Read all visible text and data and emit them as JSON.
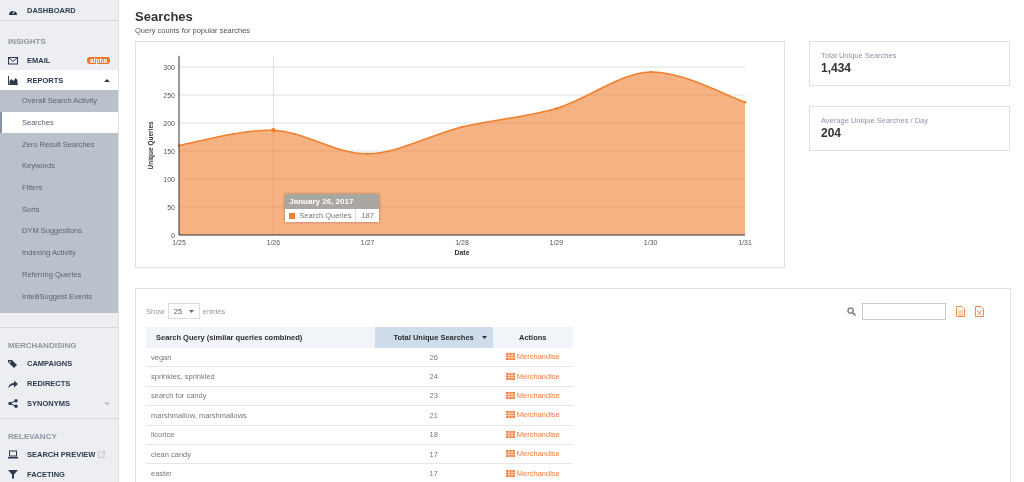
{
  "sidebar": {
    "top_items": [
      {
        "label": "DASHBOARD"
      }
    ],
    "sections": [
      {
        "heading": "INSIGHTS",
        "items": [
          {
            "label": "EMAIL",
            "badge": "alpha"
          },
          {
            "label": "REPORTS",
            "expanded": true,
            "children": [
              {
                "label": "Overall Search Activity",
                "selected": false
              },
              {
                "label": "Searches",
                "selected": true
              },
              {
                "label": "Zero Result Searches",
                "selected": false
              },
              {
                "label": "Keywords",
                "selected": false
              },
              {
                "label": "Filters",
                "selected": false
              },
              {
                "label": "Sorts",
                "selected": false
              },
              {
                "label": "DYM Suggestions",
                "selected": false
              },
              {
                "label": "Indexing Activity",
                "selected": false
              },
              {
                "label": "Referring Queries",
                "selected": false
              },
              {
                "label": "IntelliSuggest Events",
                "selected": false
              }
            ]
          }
        ]
      },
      {
        "heading": "MERCHANDISING",
        "items": [
          {
            "label": "CAMPAIGNS"
          },
          {
            "label": "REDIRECTS"
          },
          {
            "label": "SYNONYMS",
            "expanded": false
          }
        ]
      },
      {
        "heading": "RELEVANCY",
        "items": [
          {
            "label": "SEARCH PREVIEW",
            "external": true
          },
          {
            "label": "FACETING"
          }
        ]
      }
    ]
  },
  "page": {
    "title": "Searches",
    "subtitle": "Query counts for popular searches"
  },
  "chart": {
    "chart_data": {
      "type": "area",
      "xlabel": "Date",
      "ylabel": "Unique Queries",
      "categories": [
        "1/25",
        "1/26",
        "1/27",
        "1/28",
        "1/29",
        "1/30",
        "1/31"
      ],
      "series": [
        {
          "name": "Search Queries",
          "color": "#f07f2e",
          "values": [
            160,
            187,
            145,
            193,
            226,
            291,
            237
          ]
        }
      ],
      "ylim": [
        0,
        320
      ],
      "yticks": [
        0,
        50,
        100,
        150,
        200,
        250,
        300
      ],
      "grid": true
    },
    "tooltip": {
      "title": "January 26, 2017",
      "value": "187"
    }
  },
  "stats": [
    {
      "label": "Total Unique Searches",
      "value": "1,434"
    },
    {
      "label": "Average Unique Searches / Day",
      "value": "204"
    }
  ],
  "table": {
    "show_label": "Show",
    "page_size": "25",
    "entries_label": "entries",
    "columns": [
      {
        "label": "Search Query (similar queries combined)",
        "sorted": false
      },
      {
        "label": "Total Unique Searches",
        "sorted": true
      },
      {
        "label": "Actions",
        "sorted": false
      }
    ],
    "rows": [
      {
        "query": "vegan",
        "count": "26",
        "action": "Merchandise"
      },
      {
        "query": "sprinkles, sprinkled",
        "count": "24",
        "action": "Merchandise"
      },
      {
        "query": "search for candy",
        "count": "23",
        "action": "Merchandise"
      },
      {
        "query": "marshmallow, marshmallows",
        "count": "21",
        "action": "Merchandise"
      },
      {
        "query": "licorice",
        "count": "18",
        "action": "Merchandise"
      },
      {
        "query": "clean candy",
        "count": "17",
        "action": "Merchandise"
      },
      {
        "query": "easter",
        "count": "17",
        "action": "Merchandise"
      }
    ]
  }
}
